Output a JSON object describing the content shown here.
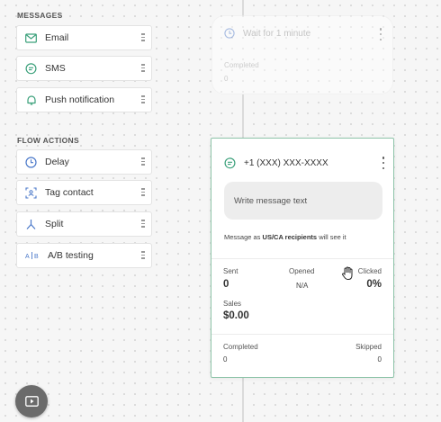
{
  "sidebar": {
    "messages_title": "MESSAGES",
    "messages": [
      {
        "label": "Email",
        "icon": "email-icon"
      },
      {
        "label": "SMS",
        "icon": "sms-icon"
      },
      {
        "label": "Push notification",
        "icon": "bell-icon"
      }
    ],
    "flow_actions_title": "FLOW ACTIONS",
    "flow_actions": [
      {
        "label": "Delay",
        "icon": "clock-icon"
      },
      {
        "label": "Tag contact",
        "icon": "tag-contact-icon"
      },
      {
        "label": "Split",
        "icon": "split-icon"
      },
      {
        "label": "A/B testing",
        "icon": "ab-testing-icon"
      }
    ]
  },
  "wait_node": {
    "title": "Wait for 1 minute",
    "completed_label": "Completed",
    "completed_value": "0"
  },
  "sms_node": {
    "phone": "+1 (XXX) XXX-XXXX",
    "message_placeholder": "Write message text",
    "note_prefix": "Message as ",
    "note_bold": "US/CA recipients",
    "note_suffix": " will see it",
    "stats": {
      "sent_label": "Sent",
      "sent_value": "0",
      "opened_label": "Opened",
      "opened_value": "N/A",
      "clicked_label": "Clicked",
      "clicked_value": "0%",
      "sales_label": "Sales",
      "sales_value": "$0.00"
    },
    "completed_label": "Completed",
    "completed_value": "0",
    "skipped_label": "Skipped",
    "skipped_value": "0"
  },
  "colors": {
    "accent": "#3aa07a",
    "icon_blue": "#4a78c9"
  }
}
